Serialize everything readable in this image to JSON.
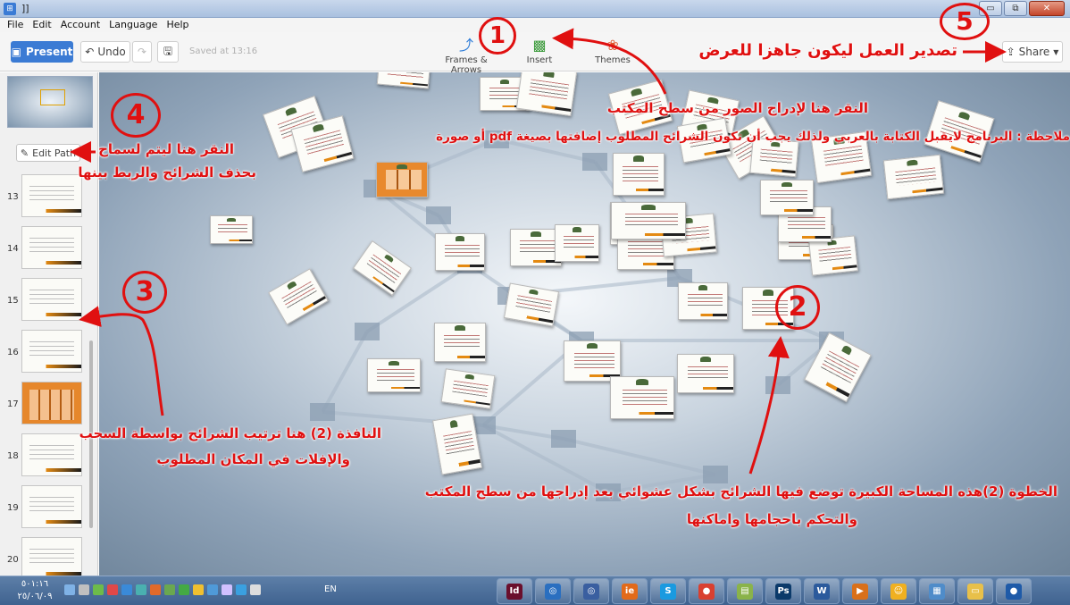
{
  "window": {
    "title": "]]",
    "controls": [
      "▭",
      "⧉",
      "✕"
    ]
  },
  "menu": [
    "File",
    "Edit",
    "Account",
    "Language",
    "Help"
  ],
  "toolbar": {
    "present_label": "Present",
    "undo_label": "Undo",
    "saved_text": "Saved at 13:16",
    "frames_label": "Frames & Arrows",
    "insert_label": "Insert",
    "themes_label": "Themes",
    "share_label": "Share"
  },
  "sidebar": {
    "edit_path_label": "Edit Path",
    "slides": [
      {
        "number": "13",
        "style": "white"
      },
      {
        "number": "14",
        "style": "white"
      },
      {
        "number": "15",
        "style": "white"
      },
      {
        "number": "16",
        "style": "white"
      },
      {
        "number": "17",
        "style": "orange"
      },
      {
        "number": "18",
        "style": "white"
      },
      {
        "number": "19",
        "style": "white"
      },
      {
        "number": "20",
        "style": "white"
      }
    ]
  },
  "annotations": {
    "circle_1": "1",
    "circle_2": "2",
    "circle_3": "3",
    "circle_4": "4",
    "circle_5": "5",
    "export_note": "تصدير العمل ليكون جاهزا للعرض",
    "insert_note": "النقر هنا لإدراج الصور من سطح المكتب",
    "language_note": "ملاحظة : البرنامج لايقبل الكتابة بالعربي ولذلك يجب أن تكون الشرائح المطلوب إضافتها  بصيغة pdf أو صورة",
    "edit_path_note_line1": "النقر هنا ليتم لسماح",
    "edit_path_note_line2": "بحذف الشرائح والربط بينها",
    "window2_note_line1": "النافذة (2) هنا ترتيب الشرائح بواسطة السحب",
    "window2_note_line2": "والإفلات في المكان المطلوب",
    "step2_note_line1": "الخطوة (2)هذه المساحة الكبيرة توضع فيها الشرائح بشكل عشوائي بعد إدراجها من سطح المكتب",
    "step2_note_line2": "والتحكم باحجامها واماكنها"
  },
  "taskbar": {
    "clock_time": "٥٠١:١٦",
    "clock_date": "٢٥/٠٦/٠٩",
    "language": "EN",
    "apps": [
      {
        "name": "indesign",
        "glyph": "Id",
        "color": "#6a0f2c"
      },
      {
        "name": "disc-app",
        "glyph": "◎",
        "color": "#2a6fc0"
      },
      {
        "name": "disc-app-2",
        "glyph": "◎",
        "color": "#3a5fa0"
      },
      {
        "name": "browser-app",
        "glyph": "ie",
        "color": "#e26a1a"
      },
      {
        "name": "skype",
        "glyph": "S",
        "color": "#1a9ae0"
      },
      {
        "name": "chrome",
        "glyph": "●",
        "color": "#d94030"
      },
      {
        "name": "folder-app",
        "glyph": "▤",
        "color": "#8ab34a"
      },
      {
        "name": "photoshop",
        "glyph": "Ps",
        "color": "#0b3a6a"
      },
      {
        "name": "word",
        "glyph": "W",
        "color": "#2b5a9c"
      },
      {
        "name": "media-player",
        "glyph": "▶",
        "color": "#d9701a"
      },
      {
        "name": "messenger",
        "glyph": "☺",
        "color": "#f0b020"
      },
      {
        "name": "calculator",
        "glyph": "▦",
        "color": "#4f8cc9"
      },
      {
        "name": "explorer",
        "glyph": "▭",
        "color": "#e8c04a"
      },
      {
        "name": "firefox",
        "glyph": "●",
        "color": "#1e5aa8"
      }
    ]
  }
}
